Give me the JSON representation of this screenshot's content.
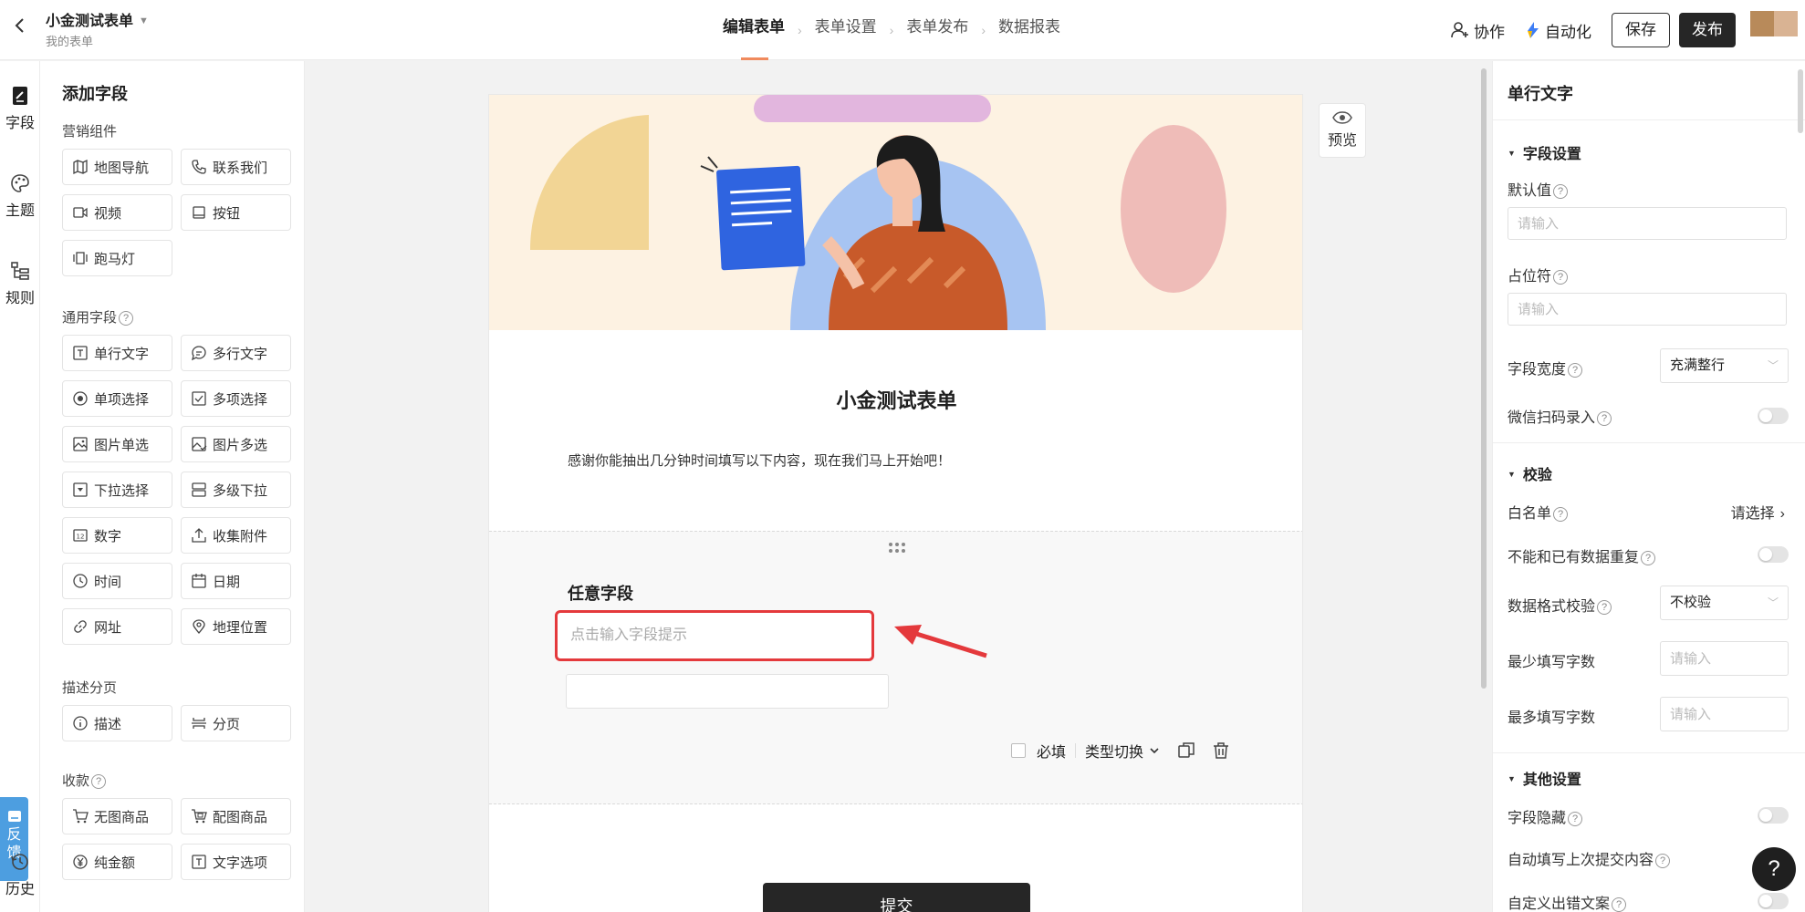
{
  "header": {
    "form_title": "小金测试表单",
    "breadcrumb": "我的表单",
    "steps": [
      "编辑表单",
      "表单设置",
      "表单发布",
      "数据报表"
    ],
    "collaborate_label": "协作",
    "automate_label": "自动化",
    "save_label": "保存",
    "publish_label": "发布"
  },
  "rail": {
    "items": [
      {
        "label": "字段",
        "icon": "edit-doc-icon"
      },
      {
        "label": "主题",
        "icon": "palette-icon"
      },
      {
        "label": "规则",
        "icon": "rules-icon"
      },
      {
        "label": "历史",
        "icon": "history-icon"
      }
    ],
    "feedback_label": "反馈"
  },
  "panel": {
    "title": "添加字段",
    "groups": [
      {
        "title": "营销组件",
        "items": [
          "地图导航",
          "联系我们",
          "视频",
          "按钮",
          "跑马灯"
        ]
      },
      {
        "title": "通用字段",
        "items": [
          "单行文字",
          "多行文字",
          "单项选择",
          "多项选择",
          "图片单选",
          "图片多选",
          "下拉选择",
          "多级下拉",
          "数字",
          "收集附件",
          "时间",
          "日期",
          "网址",
          "地理位置"
        ]
      },
      {
        "title": "描述分页",
        "items": [
          "描述",
          "分页"
        ]
      },
      {
        "title": "收款",
        "items": [
          "无图商品",
          "配图商品",
          "纯金额",
          "文字选项"
        ]
      }
    ]
  },
  "canvas": {
    "preview_label": "预览",
    "form_title": "小金测试表单",
    "description": "感谢你能抽出几分钟时间填写以下内容，现在我们马上开始吧！",
    "field": {
      "label": "任意字段",
      "hint_placeholder": "点击输入字段提示",
      "required_label": "必填",
      "type_switch_label": "类型切换"
    },
    "submit_label": "提交"
  },
  "right_panel": {
    "title": "单行文字",
    "field_settings": {
      "title": "字段设置",
      "default_value_label": "默认值",
      "default_value_placeholder": "请输入",
      "placeholder_label": "占位符",
      "placeholder_placeholder": "请输入",
      "width_label": "字段宽度",
      "width_value": "充满整行",
      "wechat_scan_label": "微信扫码录入"
    },
    "validation": {
      "title": "校验",
      "whitelist_label": "白名单",
      "whitelist_value": "请选择",
      "no_duplicate_label": "不能和已有数据重复",
      "format_label": "数据格式校验",
      "format_value": "不校验",
      "min_chars_label": "最少填写字数",
      "min_chars_placeholder": "请输入",
      "max_chars_label": "最多填写字数",
      "max_chars_placeholder": "请输入"
    },
    "other": {
      "title": "其他设置",
      "hidden_label": "字段隐藏",
      "autofill_label": "自动填写上次提交内容",
      "custom_error_label": "自定义出错文案"
    }
  },
  "help_label": "?",
  "colors": {
    "accent": "#f08a5d",
    "highlight_border": "#e4393c",
    "primary_dark": "#262626",
    "feedback_blue": "#4d9ee0"
  }
}
